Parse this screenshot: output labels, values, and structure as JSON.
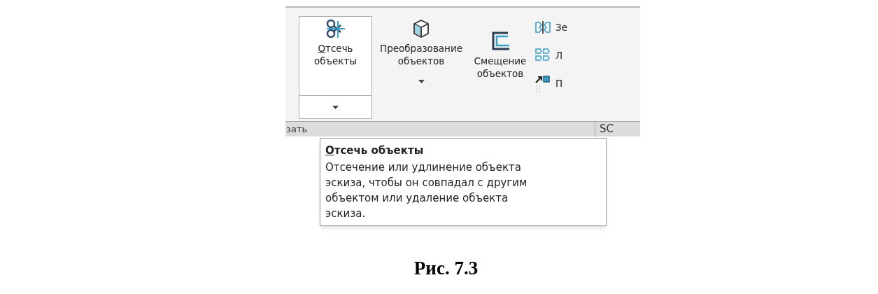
{
  "ribbon": {
    "large_buttons": [
      {
        "kind": "split",
        "label": "Отсечь объекты",
        "mnemonic_underlined": true,
        "selected": true
      },
      {
        "kind": "dropdown",
        "label": "Преобразование объектов",
        "mnemonic_underlined": false,
        "selected": false
      },
      {
        "kind": "plain",
        "label": "Смещение объектов",
        "mnemonic_underlined": false,
        "selected": false
      }
    ],
    "small_buttons": [
      {
        "label": "Зе"
      },
      {
        "label": "Л"
      },
      {
        "label": "П"
      }
    ]
  },
  "tab_strip": {
    "left_text": "зать",
    "right_text": "SC"
  },
  "tooltip": {
    "title": "Отсечь объекты",
    "title_mnemonic_underlined": true,
    "body": "Отсечение или удлинение объекта эскиза, чтобы он совпадал с другим объектом или удаление объекта эскиза."
  },
  "caption": "Рис. 7.3"
}
